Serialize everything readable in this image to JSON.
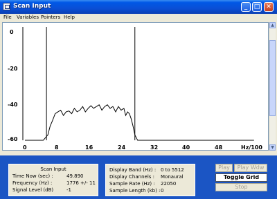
{
  "window": {
    "title": "Scan Input"
  },
  "titlebar_buttons": {
    "minimize": "_",
    "maximize": "□",
    "close": "✕"
  },
  "menu": [
    "File",
    "Variables",
    "Pointers",
    "Help"
  ],
  "plot": {
    "y_ticks": [
      "0",
      "-20",
      "-40",
      "-60"
    ],
    "x_ticks": [
      "0",
      "8",
      "16",
      "24",
      "32",
      "40",
      "48"
    ],
    "x_unit": "Hz/100",
    "pointers_hz100": [
      4.7,
      24
    ],
    "spectrum_dB": [
      [
        0,
        -60
      ],
      [
        4.0,
        -60
      ],
      [
        5.0,
        -57
      ],
      [
        5.5,
        -52
      ],
      [
        6.0,
        -49
      ],
      [
        6.6,
        -45
      ],
      [
        7.2,
        -44
      ],
      [
        7.8,
        -43
      ],
      [
        8.4,
        -46
      ],
      [
        9.0,
        -44
      ],
      [
        9.6,
        -43.5
      ],
      [
        10.2,
        -45
      ],
      [
        10.8,
        -42
      ],
      [
        11.4,
        -44
      ],
      [
        12.0,
        -43
      ],
      [
        12.6,
        -41
      ],
      [
        13.2,
        -44
      ],
      [
        13.8,
        -42
      ],
      [
        14.4,
        -40.5
      ],
      [
        15.0,
        -42
      ],
      [
        15.6,
        -41
      ],
      [
        16.2,
        -40
      ],
      [
        16.8,
        -43
      ],
      [
        17.4,
        -41
      ],
      [
        18.0,
        -40
      ],
      [
        18.6,
        -42
      ],
      [
        19.2,
        -41
      ],
      [
        19.8,
        -44
      ],
      [
        20.4,
        -41
      ],
      [
        21.0,
        -43
      ],
      [
        21.6,
        -42
      ],
      [
        22.0,
        -46
      ],
      [
        22.4,
        -44
      ],
      [
        22.8,
        -45
      ],
      [
        23.2,
        -48
      ],
      [
        23.6,
        -52
      ],
      [
        24.0,
        -57
      ],
      [
        24.6,
        -60
      ],
      [
        50.0,
        -60
      ]
    ],
    "ylim": [
      -60,
      0
    ],
    "xlim": [
      0,
      52
    ],
    "grid": false
  },
  "info_left": {
    "title": "Scan Input",
    "rows": [
      {
        "label": "Time Now (sec) :",
        "value": "49.890"
      },
      {
        "label": "Frequency (Hz) :",
        "value": "1776 +/- 11"
      },
      {
        "label": "Signal Level (dB)",
        "value": "-1"
      }
    ]
  },
  "info_mid": {
    "rows": [
      {
        "label": "Display Band (Hz) :",
        "value": "0 to 5512"
      },
      {
        "label": "Display Channels :",
        "value": "Monaural"
      },
      {
        "label": "Sample Rate (Hz) :",
        "value": "22050"
      },
      {
        "label": "Sample Length (kb) :",
        "value": "0"
      }
    ]
  },
  "buttons": {
    "play": "Play",
    "play_wdw": "Play Wdw",
    "toggle_grid": "Toggle Grid",
    "stop": "Stop"
  }
}
